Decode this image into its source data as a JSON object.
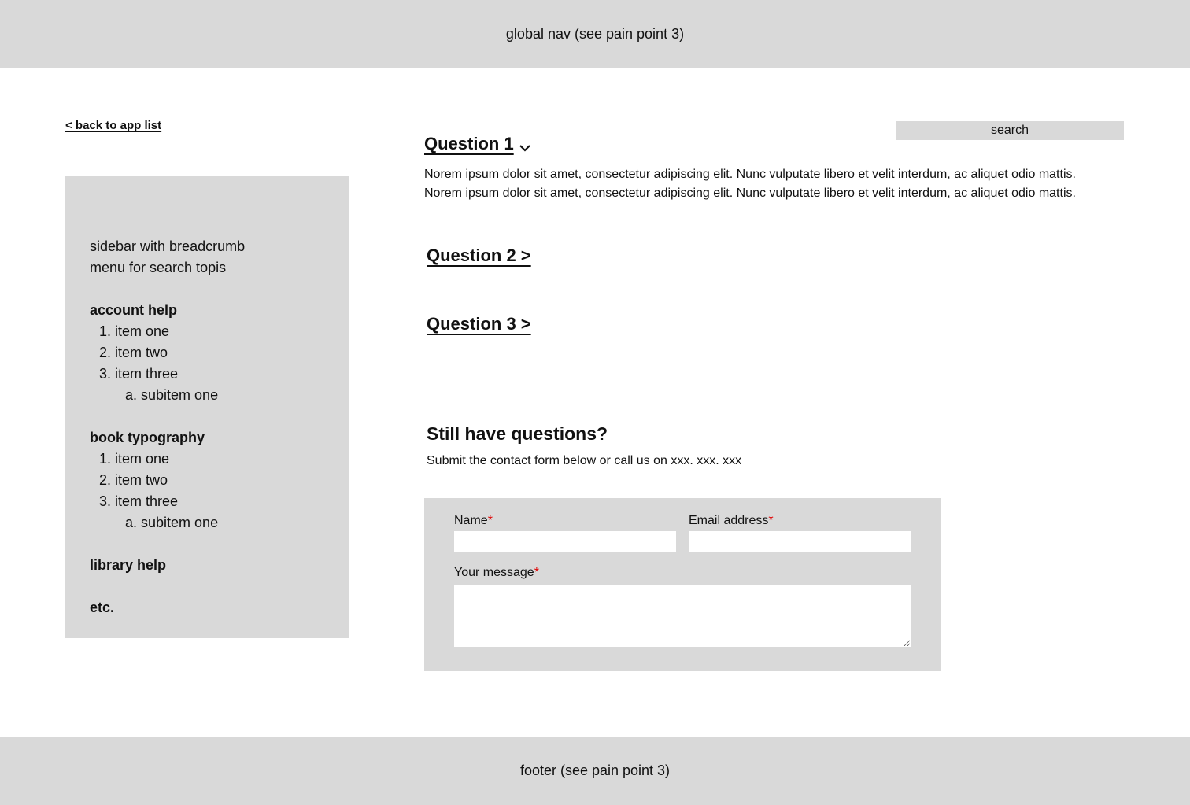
{
  "global_nav": {
    "label": "global nav (see pain point 3)"
  },
  "back_link": {
    "label": "< back to app list"
  },
  "search": {
    "label": "search"
  },
  "sidebar": {
    "intro": [
      "sidebar with breadcrumb",
      "menu for search topis"
    ],
    "sections": [
      {
        "title": "account help",
        "items": [
          {
            "num": "1.",
            "label": "item one"
          },
          {
            "num": "2.",
            "label": "item two"
          },
          {
            "num": "3.",
            "label": "item three"
          }
        ],
        "subitem": {
          "num": "a.",
          "label": "subitem one"
        }
      },
      {
        "title": "book typography",
        "items": [
          {
            "num": "1.",
            "label": "item one"
          },
          {
            "num": "2.",
            "label": "item two"
          },
          {
            "num": "3.",
            "label": "item three"
          }
        ],
        "subitem": {
          "num": "a.",
          "label": "subitem one"
        }
      },
      {
        "title": "library help"
      },
      {
        "title": "etc."
      }
    ]
  },
  "faq": {
    "questions": [
      {
        "label": "Question 1",
        "expanded": true
      },
      {
        "label": "Question 2 >"
      },
      {
        "label": "Question 3 >"
      }
    ],
    "answer_lines": [
      "Norem ipsum dolor sit amet, consectetur adipiscing elit. Nunc vulputate libero et velit interdum, ac aliquet odio mattis.",
      "Norem ipsum dolor sit amet, consectetur adipiscing elit. Nunc vulputate libero et velit interdum, ac aliquet odio mattis."
    ]
  },
  "contact": {
    "title": "Still have questions?",
    "subtitle": "Submit the contact form below or call us on xxx. xxx. xxx",
    "fields": {
      "name_label": "Name",
      "email_label": "Email address",
      "message_label": "Your message",
      "required_mark": "*"
    }
  },
  "footer": {
    "label": "footer (see pain point 3)"
  },
  "colors": {
    "panel": "#d9d9d9",
    "required": "#e00000"
  }
}
